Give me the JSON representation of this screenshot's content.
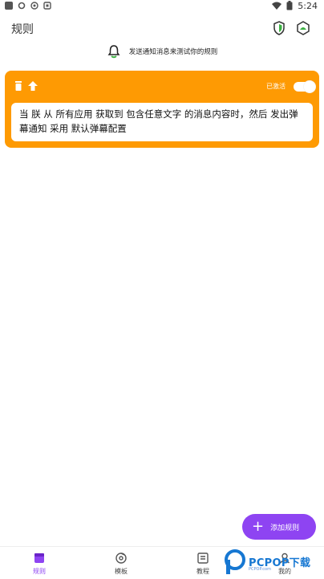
{
  "status_bar": {
    "time": "5:24",
    "icons": [
      "app-icon",
      "settings-icon",
      "circle-icon",
      "app-icon-2",
      "wifi-icon",
      "battery-icon"
    ]
  },
  "app_bar": {
    "title": "规则",
    "actions": [
      "shield-icon",
      "android-icon"
    ]
  },
  "notice": {
    "icon": "bell-icon",
    "text": "发送通知消息来测试你的规则"
  },
  "rule_card": {
    "color": "#fe9a03",
    "icons": [
      "delete-icon",
      "move-up-icon"
    ],
    "status_label": "已激活",
    "enabled": true,
    "description": "当 朕 从 所有应用 获取到 包含任意文字 的消息内容时，然后 发出弹幕通知 采用 默认弹幕配置"
  },
  "fab": {
    "label": "添加规则",
    "color": "#8e44f2"
  },
  "bottom_nav": {
    "active_color": "#8e44f2",
    "items": [
      {
        "label": "规则",
        "icon": "rules-icon"
      },
      {
        "label": "模板",
        "icon": "template-icon"
      },
      {
        "label": "教程",
        "icon": "tutorial-icon"
      },
      {
        "label": "我的",
        "icon": "profile-icon"
      }
    ]
  },
  "watermark": {
    "text": "PCPOP下载",
    "subtext": "PCPOP.com"
  }
}
